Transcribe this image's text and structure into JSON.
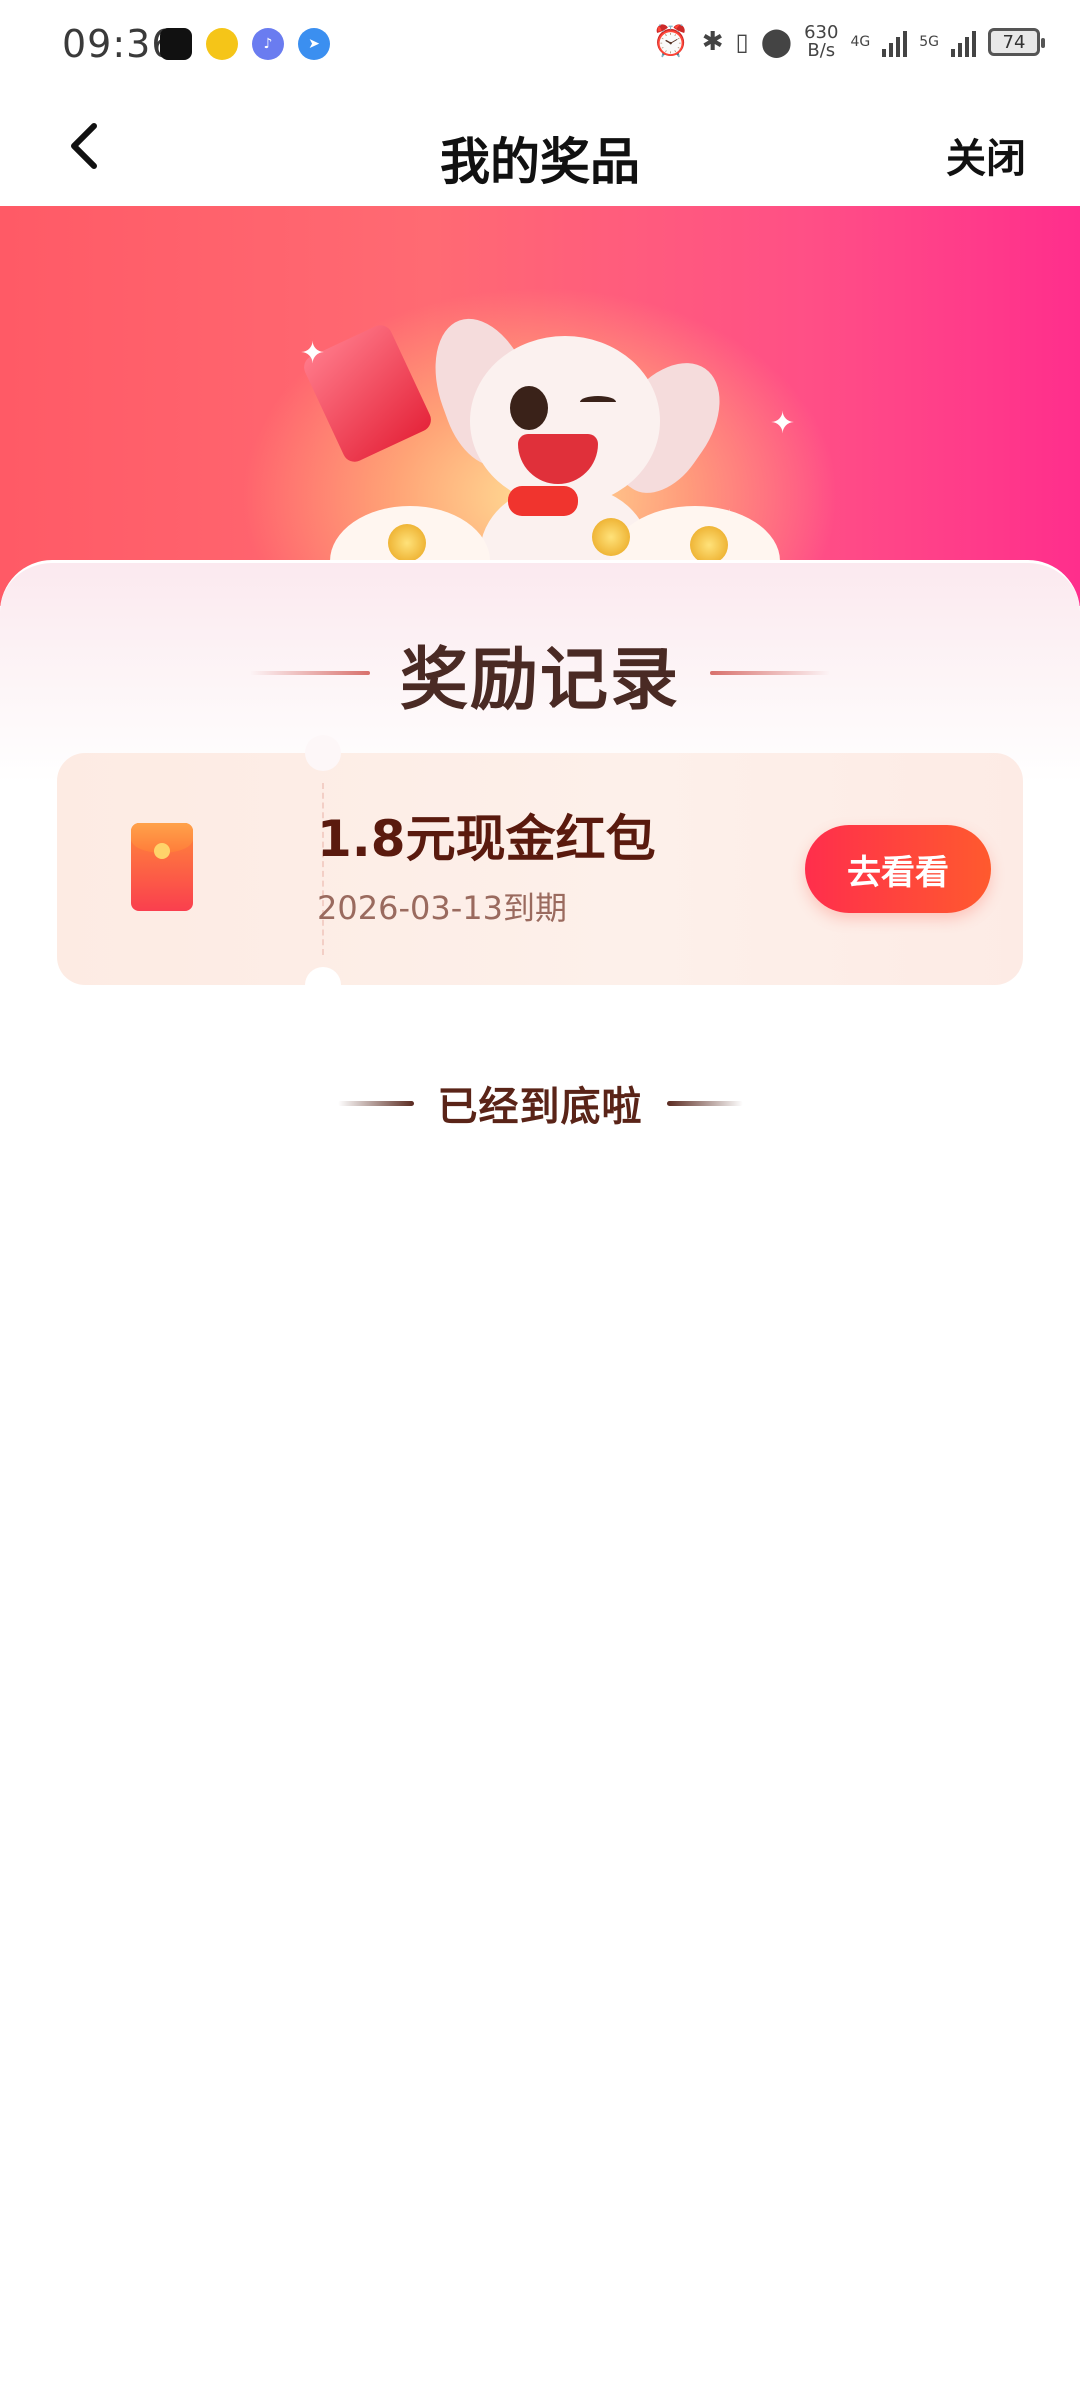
{
  "status_bar": {
    "time": "09:36",
    "net_speed_value": "630",
    "net_speed_unit": "B/s",
    "network_1": "4G",
    "network_2": "5G",
    "battery": "74"
  },
  "nav": {
    "title": "我的奖品",
    "close_label": "关闭"
  },
  "section": {
    "title": "奖励记录"
  },
  "prizes": [
    {
      "name": "1.8元现金红包",
      "expiry": "2026-03-13到期",
      "button_label": "去看看"
    }
  ],
  "footer": {
    "end_text": "已经到底啦"
  },
  "colors": {
    "brand_red": "#ff2e4c",
    "brand_orange": "#ff5a2e",
    "title_brown": "#4a2a24",
    "prize_text": "#5a1a0e",
    "expiry_text": "#9a6a5e"
  }
}
